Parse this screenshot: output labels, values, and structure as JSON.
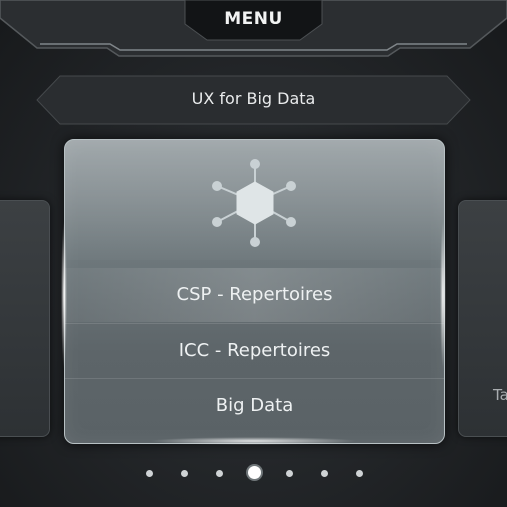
{
  "header": {
    "title": "MENU"
  },
  "section": {
    "subtitle": "UX for Big Data"
  },
  "main_card": {
    "icon": "hexagon-network-icon",
    "items": [
      {
        "label": "CSP - Repertoires",
        "active": true
      },
      {
        "label": "ICC - Repertoires",
        "active": false
      },
      {
        "label": "Big Data",
        "active": false
      }
    ]
  },
  "side_cards": {
    "right_partial_label": "Ta"
  },
  "pagination": {
    "total": 7,
    "current": 4
  },
  "colors": {
    "background": "#1a1c1e",
    "card": "#707a7e",
    "text": "#eef1f2"
  }
}
